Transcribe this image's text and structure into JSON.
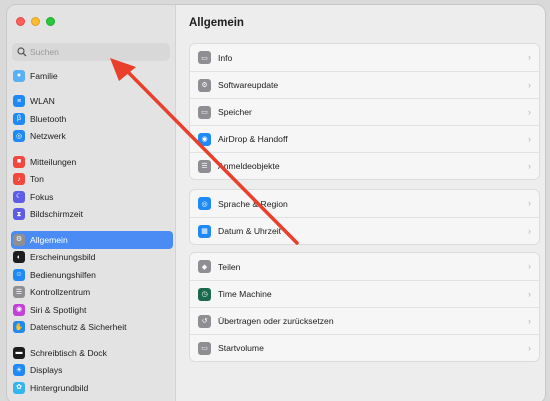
{
  "search": {
    "placeholder": "Suchen"
  },
  "sidebar": {
    "items": [
      {
        "label": "Familie",
        "icon": "family-icon",
        "color": "#5ab0f5",
        "group": 0
      },
      {
        "label": "WLAN",
        "icon": "wifi-icon",
        "color": "#1f8af5",
        "group": 1
      },
      {
        "label": "Bluetooth",
        "icon": "bluetooth-icon",
        "color": "#1f8af5",
        "group": 1
      },
      {
        "label": "Netzwerk",
        "icon": "globe-icon",
        "color": "#1f8af5",
        "group": 1
      },
      {
        "label": "Mitteilungen",
        "icon": "notifications-icon",
        "color": "#f0483e",
        "group": 2
      },
      {
        "label": "Ton",
        "icon": "sound-icon",
        "color": "#f0483e",
        "group": 2
      },
      {
        "label": "Fokus",
        "icon": "moon-icon",
        "color": "#5e5ce6",
        "group": 2
      },
      {
        "label": "Bildschirmzeit",
        "icon": "hourglass-icon",
        "color": "#5e5ce6",
        "group": 2
      },
      {
        "label": "Allgemein",
        "icon": "gear-icon",
        "color": "#8e8e93",
        "group": 3,
        "active": true
      },
      {
        "label": "Erscheinungsbild",
        "icon": "appearance-icon",
        "color": "#1d1d1f",
        "group": 3
      },
      {
        "label": "Bedienungshilfen",
        "icon": "accessibility-icon",
        "color": "#1f8af5",
        "group": 3
      },
      {
        "label": "Kontrollzentrum",
        "icon": "control-center-icon",
        "color": "#8e8e93",
        "group": 3
      },
      {
        "label": "Siri & Spotlight",
        "icon": "siri-icon",
        "color": "#c142d6",
        "group": 3
      },
      {
        "label": "Datenschutz & Sicherheit",
        "icon": "hand-icon",
        "color": "#1f8af5",
        "group": 3
      },
      {
        "label": "Schreibtisch & Dock",
        "icon": "dock-icon",
        "color": "#1d1d1f",
        "group": 4
      },
      {
        "label": "Displays",
        "icon": "display-icon",
        "color": "#1f8af5",
        "group": 4
      },
      {
        "label": "Hintergrundbild",
        "icon": "wallpaper-icon",
        "color": "#36b4f0",
        "group": 4
      }
    ]
  },
  "main": {
    "title": "Allgemein",
    "groups": [
      [
        {
          "label": "Info",
          "icon": "info-icon",
          "color": "#8e8e93"
        },
        {
          "label": "Softwareupdate",
          "icon": "software-update-icon",
          "color": "#8e8e93"
        },
        {
          "label": "Speicher",
          "icon": "storage-icon",
          "color": "#8e8e93"
        },
        {
          "label": "AirDrop & Handoff",
          "icon": "airdrop-icon",
          "color": "#1f8af5"
        },
        {
          "label": "Anmeldeobjekte",
          "icon": "login-items-icon",
          "color": "#8e8e93"
        }
      ],
      [
        {
          "label": "Sprache & Region",
          "icon": "language-icon",
          "color": "#1f8af5"
        },
        {
          "label": "Datum & Uhrzeit",
          "icon": "calendar-icon",
          "color": "#1f8af5"
        }
      ],
      [
        {
          "label": "Teilen",
          "icon": "share-icon",
          "color": "#8e8e93"
        },
        {
          "label": "Time Machine",
          "icon": "time-machine-icon",
          "color": "#1b6a4e"
        },
        {
          "label": "Übertragen oder zurücksetzen",
          "icon": "reset-icon",
          "color": "#8e8e93"
        },
        {
          "label": "Startvolume",
          "icon": "startup-disk-icon",
          "color": "#8e8e93"
        }
      ]
    ]
  },
  "annotation": {
    "arrow_color": "#e8402a"
  }
}
